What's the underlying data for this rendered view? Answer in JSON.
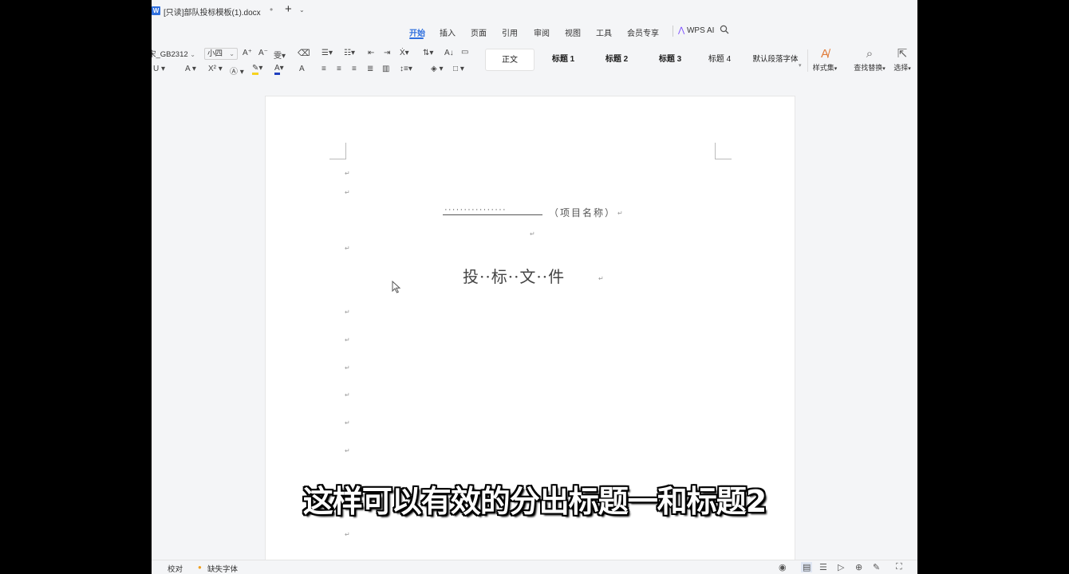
{
  "titlebar": {
    "app_icon": "W",
    "doc_title": "[只读]部队投标模板(1).docx",
    "tab_dot": "•",
    "new_tab": "+",
    "new_tab_caret": "⌄"
  },
  "menu": {
    "items": [
      "开始",
      "插入",
      "页面",
      "引用",
      "审阅",
      "视图",
      "工具",
      "会员专享"
    ],
    "ai_label": "WPS AI",
    "search_icon": "search-icon"
  },
  "ribbon": {
    "font_name": "宋_GB2312",
    "font_size": "小四",
    "styles": [
      "正文",
      "标题 1",
      "标题 2",
      "标题 3",
      "标题 4",
      "默认段落字体"
    ],
    "style_set_label": "样式集",
    "find_replace_label": "查找替换",
    "select_label": "选择"
  },
  "document": {
    "project_dots": "················",
    "project_name": "（项目名称）",
    "heading": "投··标··文··件",
    "para_mark": "↵"
  },
  "subtitle": "这样可以有效的分出标题一和标题2",
  "statusbar": {
    "proofread": "校对",
    "missing_font": "缺失字体"
  },
  "colors": {
    "accent": "#2f6fde",
    "page": "#ffffff",
    "workspace": "#f4f5f7"
  }
}
